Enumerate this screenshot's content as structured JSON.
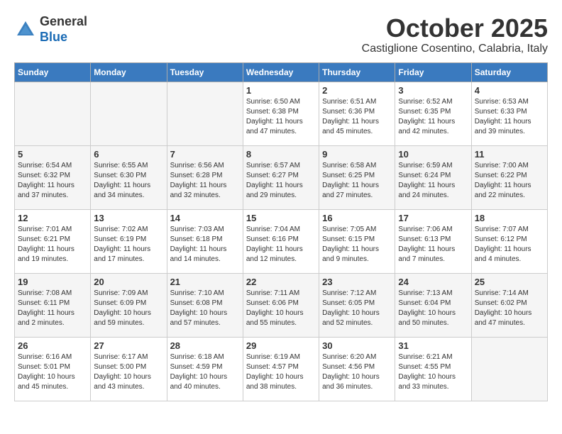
{
  "header": {
    "logo_line1": "General",
    "logo_line2": "Blue",
    "month_title": "October 2025",
    "location": "Castiglione Cosentino, Calabria, Italy"
  },
  "days_of_week": [
    "Sunday",
    "Monday",
    "Tuesday",
    "Wednesday",
    "Thursday",
    "Friday",
    "Saturday"
  ],
  "weeks": [
    [
      {
        "day": "",
        "empty": true
      },
      {
        "day": "",
        "empty": true
      },
      {
        "day": "",
        "empty": true
      },
      {
        "day": "1",
        "sunrise": "6:50 AM",
        "sunset": "6:38 PM",
        "daylight": "11 hours and 47 minutes."
      },
      {
        "day": "2",
        "sunrise": "6:51 AM",
        "sunset": "6:36 PM",
        "daylight": "11 hours and 45 minutes."
      },
      {
        "day": "3",
        "sunrise": "6:52 AM",
        "sunset": "6:35 PM",
        "daylight": "11 hours and 42 minutes."
      },
      {
        "day": "4",
        "sunrise": "6:53 AM",
        "sunset": "6:33 PM",
        "daylight": "11 hours and 39 minutes."
      }
    ],
    [
      {
        "day": "5",
        "sunrise": "6:54 AM",
        "sunset": "6:32 PM",
        "daylight": "11 hours and 37 minutes."
      },
      {
        "day": "6",
        "sunrise": "6:55 AM",
        "sunset": "6:30 PM",
        "daylight": "11 hours and 34 minutes."
      },
      {
        "day": "7",
        "sunrise": "6:56 AM",
        "sunset": "6:28 PM",
        "daylight": "11 hours and 32 minutes."
      },
      {
        "day": "8",
        "sunrise": "6:57 AM",
        "sunset": "6:27 PM",
        "daylight": "11 hours and 29 minutes."
      },
      {
        "day": "9",
        "sunrise": "6:58 AM",
        "sunset": "6:25 PM",
        "daylight": "11 hours and 27 minutes."
      },
      {
        "day": "10",
        "sunrise": "6:59 AM",
        "sunset": "6:24 PM",
        "daylight": "11 hours and 24 minutes."
      },
      {
        "day": "11",
        "sunrise": "7:00 AM",
        "sunset": "6:22 PM",
        "daylight": "11 hours and 22 minutes."
      }
    ],
    [
      {
        "day": "12",
        "sunrise": "7:01 AM",
        "sunset": "6:21 PM",
        "daylight": "11 hours and 19 minutes."
      },
      {
        "day": "13",
        "sunrise": "7:02 AM",
        "sunset": "6:19 PM",
        "daylight": "11 hours and 17 minutes."
      },
      {
        "day": "14",
        "sunrise": "7:03 AM",
        "sunset": "6:18 PM",
        "daylight": "11 hours and 14 minutes."
      },
      {
        "day": "15",
        "sunrise": "7:04 AM",
        "sunset": "6:16 PM",
        "daylight": "11 hours and 12 minutes."
      },
      {
        "day": "16",
        "sunrise": "7:05 AM",
        "sunset": "6:15 PM",
        "daylight": "11 hours and 9 minutes."
      },
      {
        "day": "17",
        "sunrise": "7:06 AM",
        "sunset": "6:13 PM",
        "daylight": "11 hours and 7 minutes."
      },
      {
        "day": "18",
        "sunrise": "7:07 AM",
        "sunset": "6:12 PM",
        "daylight": "11 hours and 4 minutes."
      }
    ],
    [
      {
        "day": "19",
        "sunrise": "7:08 AM",
        "sunset": "6:11 PM",
        "daylight": "11 hours and 2 minutes."
      },
      {
        "day": "20",
        "sunrise": "7:09 AM",
        "sunset": "6:09 PM",
        "daylight": "10 hours and 59 minutes."
      },
      {
        "day": "21",
        "sunrise": "7:10 AM",
        "sunset": "6:08 PM",
        "daylight": "10 hours and 57 minutes."
      },
      {
        "day": "22",
        "sunrise": "7:11 AM",
        "sunset": "6:06 PM",
        "daylight": "10 hours and 55 minutes."
      },
      {
        "day": "23",
        "sunrise": "7:12 AM",
        "sunset": "6:05 PM",
        "daylight": "10 hours and 52 minutes."
      },
      {
        "day": "24",
        "sunrise": "7:13 AM",
        "sunset": "6:04 PM",
        "daylight": "10 hours and 50 minutes."
      },
      {
        "day": "25",
        "sunrise": "7:14 AM",
        "sunset": "6:02 PM",
        "daylight": "10 hours and 47 minutes."
      }
    ],
    [
      {
        "day": "26",
        "sunrise": "6:16 AM",
        "sunset": "5:01 PM",
        "daylight": "10 hours and 45 minutes."
      },
      {
        "day": "27",
        "sunrise": "6:17 AM",
        "sunset": "5:00 PM",
        "daylight": "10 hours and 43 minutes."
      },
      {
        "day": "28",
        "sunrise": "6:18 AM",
        "sunset": "4:59 PM",
        "daylight": "10 hours and 40 minutes."
      },
      {
        "day": "29",
        "sunrise": "6:19 AM",
        "sunset": "4:57 PM",
        "daylight": "10 hours and 38 minutes."
      },
      {
        "day": "30",
        "sunrise": "6:20 AM",
        "sunset": "4:56 PM",
        "daylight": "10 hours and 36 minutes."
      },
      {
        "day": "31",
        "sunrise": "6:21 AM",
        "sunset": "4:55 PM",
        "daylight": "10 hours and 33 minutes."
      },
      {
        "day": "",
        "empty": true
      }
    ]
  ]
}
